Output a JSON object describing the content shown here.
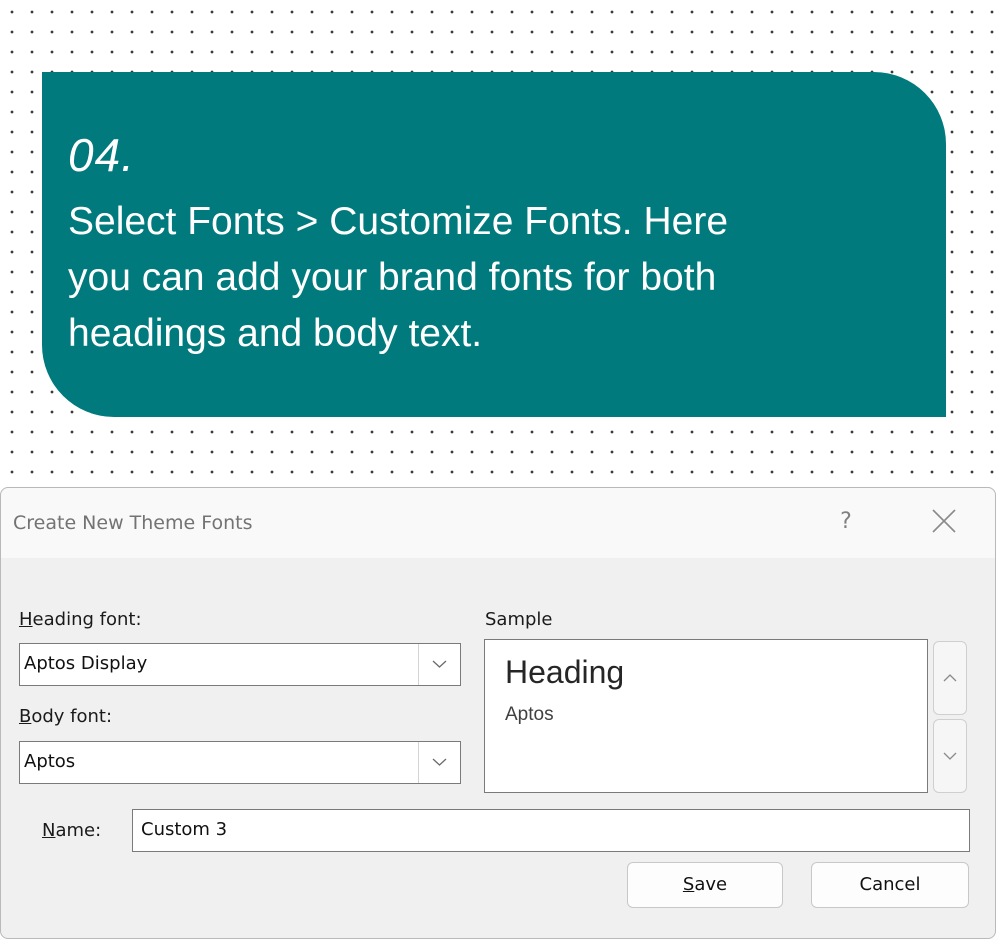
{
  "callout": {
    "step": "04.",
    "lines": [
      "Select Fonts > Customize Fonts. Here",
      "you can add your brand fonts for both",
      "headings and body text."
    ]
  },
  "dialog": {
    "title": "Create New Theme Fonts",
    "help_label": "?",
    "heading_font": {
      "label_mnemonic": "H",
      "label_rest": "eading font:",
      "value": "Aptos Display"
    },
    "body_font": {
      "label_mnemonic": "B",
      "label_rest": "ody font:",
      "value": "Aptos"
    },
    "sample": {
      "label": "Sample",
      "heading_text": "Heading",
      "body_text": "Aptos"
    },
    "name": {
      "label_mnemonic": "N",
      "label_rest": "ame:",
      "value": "Custom 3"
    },
    "buttons": {
      "save_mnemonic": "S",
      "save_rest": "ave",
      "cancel": "Cancel"
    }
  },
  "colors": {
    "callout_bg": "#017a7d",
    "dialog_bg": "#f0f0f0",
    "text": "#1a1a1a"
  },
  "icons": [
    "close-icon",
    "chevron-down-icon",
    "chevron-up-icon"
  ]
}
